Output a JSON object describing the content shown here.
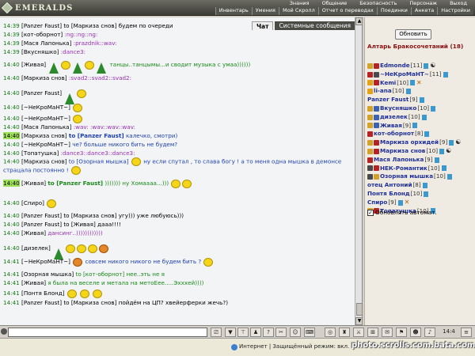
{
  "app": {
    "logo_text": "EMERALDS"
  },
  "top_menu_1": [
    "Знания",
    "Общение",
    "Безопасность",
    "Персонаж",
    "Выход"
  ],
  "top_menu_2": [
    "Инвентарь",
    "Умения",
    "Мой Скролл",
    "Отчет о переводах",
    "Поединки",
    "Анкета",
    "Настройки"
  ],
  "tabs": {
    "chat": "Чат",
    "system": "Системные сообщения"
  },
  "chat_lines": [
    {
      "time": "14:39",
      "nick": "[Panzer Faust]",
      "text": "to [Маркиза снов] будем по очереди",
      "color": "black"
    },
    {
      "time": "14:39",
      "nick": "[кот-оборнот]",
      "text": ":ng::ng::ng:",
      "color": "purple"
    },
    {
      "time": "14:39",
      "nick": "[Мася Лапонька]",
      "text": ":prazdnik::wav:",
      "color": "purple"
    },
    {
      "time": "14:39",
      "nick": "[Вкусняшко]",
      "text": ":dance3:",
      "color": "purple"
    },
    {
      "time": "14:40",
      "nick": "[Живая]",
      "text": "танцы..танцымы...и сводит музыка с умаа))))))",
      "color": "green"
    },
    {
      "time": "14:40",
      "nick": "[Маркиза снов]",
      "text": ":svad2::svad2::svad2:",
      "color": "purple"
    },
    {
      "time": "14:40",
      "nick": "[Panzer Faust]",
      "text": "",
      "color": "black"
    },
    {
      "time": "14:40",
      "nick": "[~НеКроМаНТ~]",
      "text": "",
      "color": "black"
    },
    {
      "time": "14:40",
      "nick": "[~НеКроМаНТ~]",
      "text": "",
      "color": "black"
    },
    {
      "time": "14:40",
      "nick": "[Мася Лапонька]",
      "text": ":wav: :wav::wav::wav:",
      "color": "purple"
    },
    {
      "time": "14:40",
      "nick": "[Маркиза снов]",
      "to": "to [Panzer Faust]",
      "text": "калечко, смотри)",
      "color": "blue"
    },
    {
      "time": "14:40",
      "nick": "[~НеКроМаНТ~]",
      "text": "че? больше никого бить не будем?",
      "color": "blue"
    },
    {
      "time": "14:40",
      "nick": "[Топатушка]",
      "text": ":dance3::dance3::dance3:",
      "color": "purple"
    },
    {
      "time": "14:40",
      "nick": "[Маркиза снов]",
      "text": "to [Озорная мышка]",
      "text2": "ну если спутал , то слава богу ! а то меня одна мышка в демонсе страцала постоянно !",
      "color": "blue"
    },
    {
      "time": "14:40",
      "nick": "[Живая]",
      "to": "to [Panzer Faust]",
      "text": "))))))) ну Хомаааа...)))",
      "color": "green"
    },
    {
      "time": "14:40",
      "nick": "[Спиро]",
      "text": "",
      "color": "black"
    },
    {
      "time": "14:40",
      "nick": "[Panzer Faust]",
      "text": "to [Маркиза снов] угу))) уже любуюсь)))",
      "color": "black"
    },
    {
      "time": "14:40",
      "nick": "[Panzer Faust]",
      "text": "to [Живая] дааа!!!!",
      "color": "black"
    },
    {
      "time": "14:40",
      "nick": "[Живая]",
      "text": "дансинг..))))))))))))",
      "color": "purple"
    },
    {
      "time": "14:40",
      "nick": "[дизелек]",
      "text": "",
      "color": "black"
    },
    {
      "time": "14:41",
      "nick": "[~НеКроМаНТ~]",
      "text": "совсем никого никого не будем бить ?",
      "color": "blue"
    },
    {
      "time": "14:41",
      "nick": "[Озорная мышка]",
      "text": "to [кот-оборнот] нее..эть не я",
      "color": "green"
    },
    {
      "time": "14:41",
      "nick": "[Живая]",
      "text": "я была на веселе и метала на метоЕее.....Эхххей))))",
      "color": "green"
    },
    {
      "time": "14:41",
      "nick": "[Понтя Блонд]",
      "text": "",
      "color": "black"
    },
    {
      "time": "14:41",
      "nick": "[Panzer Faust]",
      "text": "to [Маркиза снов] пойдём на ЦП? хвейерферки жечь?)",
      "color": "black"
    }
  ],
  "right_panel": {
    "refresh_button": "Обновить",
    "room_title": "Алтарь Бракосочетаний (18)",
    "auto_refresh_label": "Обновлять автомат.",
    "users": [
      {
        "name": "Edmonde",
        "level": "[11]"
      },
      {
        "name": "~НеКроМаНТ~",
        "level": "[11]"
      },
      {
        "name": "Kemi",
        "level": "[10]"
      },
      {
        "name": "li-ana",
        "level": "[10]"
      },
      {
        "name": "Panzer Faust",
        "level": "[9]"
      },
      {
        "name": "Вкусняшко",
        "level": "[10]"
      },
      {
        "name": "дизелек",
        "level": "[10]"
      },
      {
        "name": "Живая",
        "level": "[9]"
      },
      {
        "name": "кот-оборнот",
        "level": "[8]"
      },
      {
        "name": "Маркиза орхидей",
        "level": "[9]"
      },
      {
        "name": "Маркиза снов",
        "level": "[10]"
      },
      {
        "name": "Мася Лапонька",
        "level": "[9]"
      },
      {
        "name": "НЕК-Романтик",
        "level": "[10]"
      },
      {
        "name": "Озорная мышка",
        "level": "[10]"
      },
      {
        "name": "отец Антоний",
        "level": "[8]"
      },
      {
        "name": "Понтя Блонд",
        "level": "[10]"
      },
      {
        "name": "Спиро",
        "level": "[9]"
      },
      {
        "name": "Топатушка",
        "level": "[10]"
      }
    ]
  },
  "clock": "14:4",
  "status": {
    "text": "Интернет | Защищённый режим: вкл."
  },
  "watermark": "photo.scrolls.com.bata.com"
}
